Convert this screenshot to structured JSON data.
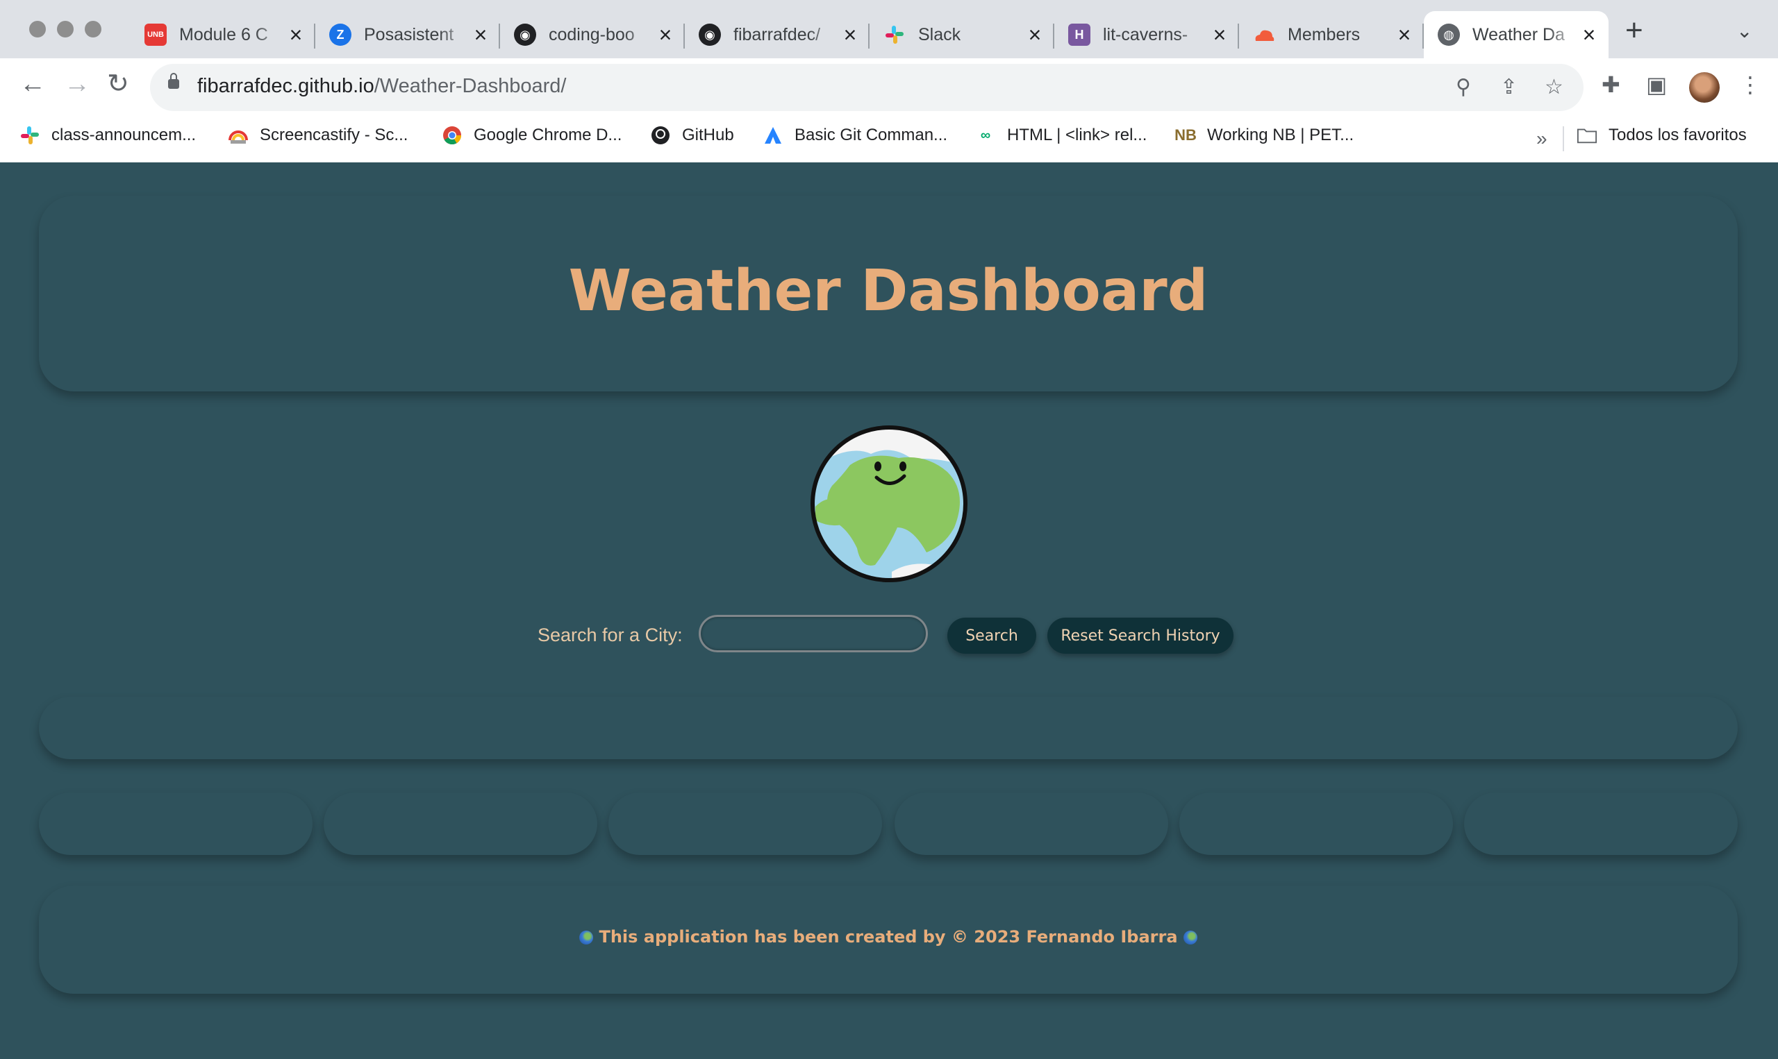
{
  "browser": {
    "tabs": [
      {
        "title": "Module 6 C",
        "favicon": "unb-icon",
        "color": "#e53935",
        "active": false
      },
      {
        "title": "Posasistent",
        "favicon": "z-icon",
        "color": "#1a73e8",
        "active": false
      },
      {
        "title": "coding-boo",
        "favicon": "github-icon",
        "color": "#202124",
        "active": false
      },
      {
        "title": "fibarrafdec/",
        "favicon": "github-icon",
        "color": "#202124",
        "active": false
      },
      {
        "title": "Slack",
        "favicon": "slack-icon",
        "color": "#4a154b",
        "active": false
      },
      {
        "title": "lit-caverns-",
        "favicon": "heroku-icon",
        "color": "#79589f",
        "active": false
      },
      {
        "title": "Members",
        "favicon": "cloud-icon",
        "color": "#f25c3c",
        "active": false
      },
      {
        "title": "Weather Da",
        "favicon": "globe-icon",
        "color": "#5f6368",
        "active": true
      }
    ],
    "url_host": "fibarrafdec.github.io",
    "url_path": "/Weather-Dashboard/",
    "bookmarks": [
      {
        "label": "class-announcem...",
        "icon": "slack-icon"
      },
      {
        "label": "Screencastify - Sc...",
        "icon": "rainbow-icon"
      },
      {
        "label": "Google Chrome D...",
        "icon": "chrome-icon"
      },
      {
        "label": "GitHub",
        "icon": "github-icon"
      },
      {
        "label": "Basic Git Comman...",
        "icon": "atlassian-icon"
      },
      {
        "label": "HTML | <link> rel...",
        "icon": "w3-icon"
      },
      {
        "label": "Working NB | PET...",
        "icon": "nb-icon"
      }
    ],
    "bookmarks_more": "»",
    "all_bookmarks": "Todos los favoritos"
  },
  "page": {
    "title": "Weather Dashboard",
    "search_label": "Search for a City:",
    "search_value": "",
    "search_button": "Search",
    "reset_button": "Reset Search History",
    "footer_text": "This application has been created by © 2023 Fernando Ibarra"
  },
  "colors": {
    "background": "#2f525c",
    "accent": "#e8ad7b",
    "button_bg": "#0f3138"
  }
}
